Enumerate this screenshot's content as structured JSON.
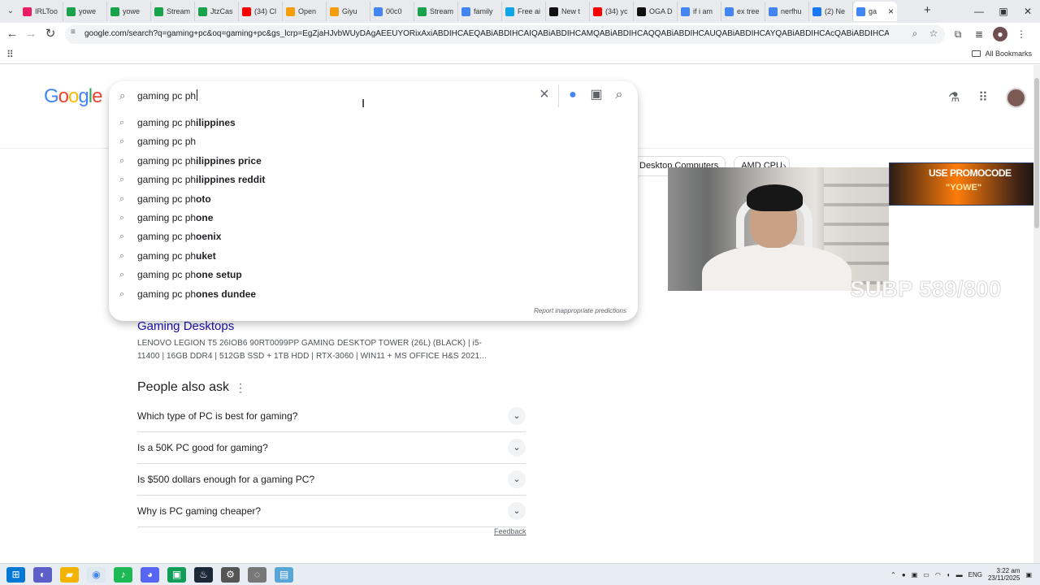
{
  "browser": {
    "tabs": [
      {
        "label": "IRLToo",
        "color": "#e91e63"
      },
      {
        "label": "yowe",
        "color": "#16a34a"
      },
      {
        "label": "yowe",
        "color": "#16a34a"
      },
      {
        "label": "Stream",
        "color": "#16a34a"
      },
      {
        "label": "JtzCas",
        "color": "#16a34a"
      },
      {
        "label": "(34) Cl",
        "color": "#ff0000"
      },
      {
        "label": "Open",
        "color": "#f59e0b"
      },
      {
        "label": "Giyu",
        "color": "#f59e0b"
      },
      {
        "label": "00c0",
        "color": "#4285f4"
      },
      {
        "label": "Stream",
        "color": "#16a34a"
      },
      {
        "label": "family",
        "color": "#4285f4"
      },
      {
        "label": "Free ai",
        "color": "#0ea5e9"
      },
      {
        "label": "New t",
        "color": "#111"
      },
      {
        "label": "(34) yc",
        "color": "#ff0000"
      },
      {
        "label": "OGA D",
        "color": "#111"
      },
      {
        "label": "if i am",
        "color": "#4285f4"
      },
      {
        "label": "ex tree",
        "color": "#4285f4"
      },
      {
        "label": "nerfhu",
        "color": "#4285f4"
      },
      {
        "label": "(2) Ne",
        "color": "#1877f2"
      },
      {
        "label": "ga",
        "color": "#4285f4",
        "active": true
      }
    ],
    "url": "google.com/search?q=gaming+pc&oq=gaming+pc&gs_lcrp=EgZjaHJvbWUyDAgAEEUYORixAxiABDIHCAEQABiABDIHCAIQABiABDIHCAMQABiABDIHCAQQABiABDIHCAUQABiABDIHCAYQABiABDIHCAcQABiABDIHCAgQABiABDIHCAkQABiABNI...",
    "bookmarks_label": "All Bookmarks"
  },
  "google": {
    "logo": "Google",
    "search": {
      "query": "gaming pc ph",
      "suggestions": [
        {
          "base": "gaming pc ph",
          "completion": "ilippines"
        },
        {
          "base": "gaming pc ph",
          "completion": ""
        },
        {
          "base": "gaming pc ph",
          "completion": "ilippines price"
        },
        {
          "base": "gaming pc ph",
          "completion": "ilippines reddit"
        },
        {
          "base": "gaming pc ph",
          "completion": "oto"
        },
        {
          "base": "gaming pc ph",
          "completion": "one"
        },
        {
          "base": "gaming pc ph",
          "completion": "oenix"
        },
        {
          "base": "gaming pc ph",
          "completion": "uket"
        },
        {
          "base": "gaming pc ph",
          "completion": "one setup"
        },
        {
          "base": "gaming pc ph",
          "completion": "ones dundee"
        }
      ],
      "report_label": "Report inappropriate predictions"
    },
    "filters": [
      "Desktop Computers",
      "AMD CPU"
    ],
    "result": {
      "title": "Gaming Desktops",
      "snippet": "LENOVO LEGION T5 26IOB6 90RT0099PP GAMING DESKTOP TOWER (26L) (BLACK) | i5-11400 | 16GB DDR4 | 512GB SSD + 1TB HDD | RTX-3060 | WIN11 + MS OFFICE H&S 2021..."
    },
    "people_also_ask": {
      "title": "People also ask",
      "questions": [
        "Which type of PC is best for gaming?",
        "Is a 50K PC good for gaming?",
        "Is $500 dollars enough for a gaming PC?",
        "Why is PC gaming cheaper?"
      ],
      "feedback": "Feedback"
    }
  },
  "overlays": {
    "promo_line1": "USE PROMOCODE",
    "promo_line2": "\"YOWE\"",
    "counter": "SUBP 589/800"
  },
  "taskbar": {
    "language": "ENG",
    "time": "3:22 am",
    "date": "23/11/2025"
  }
}
